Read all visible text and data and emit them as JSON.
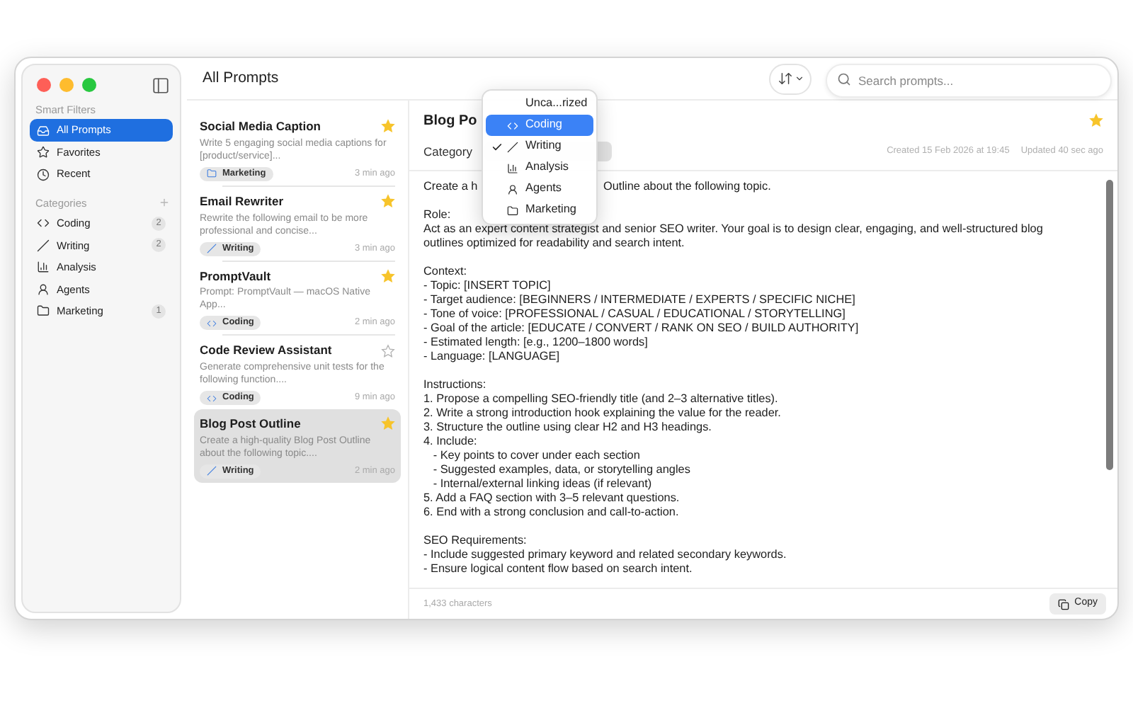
{
  "window": {
    "title": "All Prompts"
  },
  "search": {
    "placeholder": "Search prompts..."
  },
  "sidebar": {
    "sections": [
      {
        "heading": "Smart Filters",
        "can_add": false,
        "items": [
          {
            "label": "All Prompts",
            "kind": "inbox",
            "selected": true
          },
          {
            "label": "Favorites",
            "kind": "star",
            "selected": false
          },
          {
            "label": "Recent",
            "kind": "clock",
            "selected": false
          }
        ]
      },
      {
        "heading": "Categories",
        "can_add": true,
        "items": [
          {
            "label": "Coding",
            "kind": "code",
            "count": "2",
            "selected": false
          },
          {
            "label": "Writing",
            "kind": "pen",
            "count": "2",
            "selected": false
          },
          {
            "label": "Analysis",
            "kind": "chart",
            "selected": false
          },
          {
            "label": "Agents",
            "kind": "person",
            "selected": false
          },
          {
            "label": "Marketing",
            "kind": "folder",
            "count": "1",
            "selected": false
          }
        ]
      }
    ]
  },
  "prompts": [
    {
      "title": "Social Media Caption",
      "preview": "Write 5 engaging social media captions for [product/service]...",
      "tag": {
        "label": "Marketing",
        "kind": "folder"
      },
      "time": "3 min ago",
      "starred": true,
      "selected": false
    },
    {
      "title": "Email Rewriter",
      "preview": "Rewrite the following email to be more professional and concise...",
      "tag": {
        "label": "Writing",
        "kind": "pen"
      },
      "time": "3 min ago",
      "starred": true,
      "selected": false
    },
    {
      "title": "PromptVault",
      "preview": "Prompt: PromptVault — macOS Native App...",
      "tag": {
        "label": "Coding",
        "kind": "code"
      },
      "time": "2 min ago",
      "starred": true,
      "selected": false
    },
    {
      "title": "Code Review Assistant",
      "preview": "Generate comprehensive unit tests for the following function....",
      "tag": {
        "label": "Coding",
        "kind": "code"
      },
      "time": "9 min ago",
      "starred": false,
      "selected": false
    },
    {
      "title": "Blog Post Outline",
      "preview": "Create a high-quality Blog Post Outline about the following topic....",
      "tag": {
        "label": "Writing",
        "kind": "pen"
      },
      "time": "2 min ago",
      "starred": true,
      "selected": true
    }
  ],
  "detail": {
    "title": "Blog Po",
    "starred": true,
    "category_label": "Category",
    "created": "Created 15 Feb 2026 at 19:45",
    "updated": "Updated 40 sec ago",
    "first_line": [
      "Create a h",
      "Outline about the following topic."
    ],
    "paragraphs": [
      [
        "Role:",
        "Act as an expert content strategist and senior SEO writer. Your goal is to design clear, engaging, and well-structured blog",
        "outlines optimized for readability and search intent."
      ],
      [
        "Context:",
        "- Topic: [INSERT TOPIC]",
        "- Target audience: [BEGINNERS / INTERMEDIATE / EXPERTS / SPECIFIC NICHE]",
        "- Tone of voice: [PROFESSIONAL / CASUAL / EDUCATIONAL / STORYTELLING]",
        "- Goal of the article: [EDUCATE / CONVERT / RANK ON SEO / BUILD AUTHORITY]",
        "- Estimated length: [e.g., 1200–1800 words]",
        "- Language: [LANGUAGE]"
      ],
      [
        "Instructions:",
        "1. Propose a compelling SEO-friendly title (and 2–3 alternative titles).",
        "2. Write a strong introduction hook explaining the value for the reader.",
        "3. Structure the outline using clear H2 and H3 headings.",
        "4. Include:",
        "   - Key points to cover under each section",
        "   - Suggested examples, data, or storytelling angles",
        "   - Internal/external linking ideas (if relevant)",
        "5. Add a FAQ section with 3–5 relevant questions.",
        "6. End with a strong conclusion and call-to-action."
      ],
      [
        "SEO Requirements:",
        "- Include suggested primary keyword and related secondary keywords.",
        "- Ensure logical content flow based on search intent."
      ]
    ],
    "char_count": "1,433 characters",
    "copy_button": "Copy"
  },
  "category_menu": {
    "items": [
      {
        "label": "Unca...rized",
        "kind": "none",
        "selected": false,
        "checked": false
      },
      {
        "label": "Coding",
        "kind": "code",
        "selected": true,
        "checked": false
      },
      {
        "label": "Writing",
        "kind": "pen",
        "selected": false,
        "checked": true
      },
      {
        "label": "Analysis",
        "kind": "chart",
        "selected": false,
        "checked": false
      },
      {
        "label": "Agents",
        "kind": "person",
        "selected": false,
        "checked": false
      },
      {
        "label": "Marketing",
        "kind": "folder",
        "selected": false,
        "checked": false
      }
    ]
  }
}
